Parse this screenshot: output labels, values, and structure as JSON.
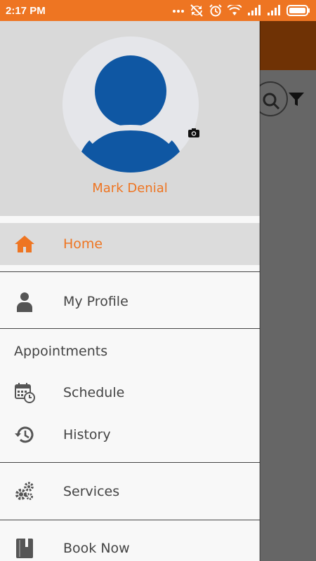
{
  "status_bar": {
    "time": "2:17 PM",
    "icons": [
      "more-dots-icon",
      "sync-off-icon",
      "alarm-icon",
      "wifi-icon",
      "signal-icon",
      "signal-icon",
      "battery-icon"
    ]
  },
  "drawer": {
    "user_name": "Mark Denial",
    "items": [
      {
        "label": "Home",
        "icon": "home-icon",
        "active": true
      },
      {
        "label": "My Profile",
        "icon": "person-icon"
      },
      {
        "label": "Schedule",
        "icon": "calendar-clock-icon"
      },
      {
        "label": "History",
        "icon": "history-icon"
      },
      {
        "label": "Services",
        "icon": "gears-icon"
      },
      {
        "label": "Book Now",
        "icon": "book-icon"
      }
    ],
    "section_appointments": "Appointments"
  },
  "colors": {
    "accent": "#ee7522",
    "header_bg": "#d9d9d9",
    "avatar_blue": "#0f57a3",
    "toolbar_dark": "#6f3205"
  }
}
